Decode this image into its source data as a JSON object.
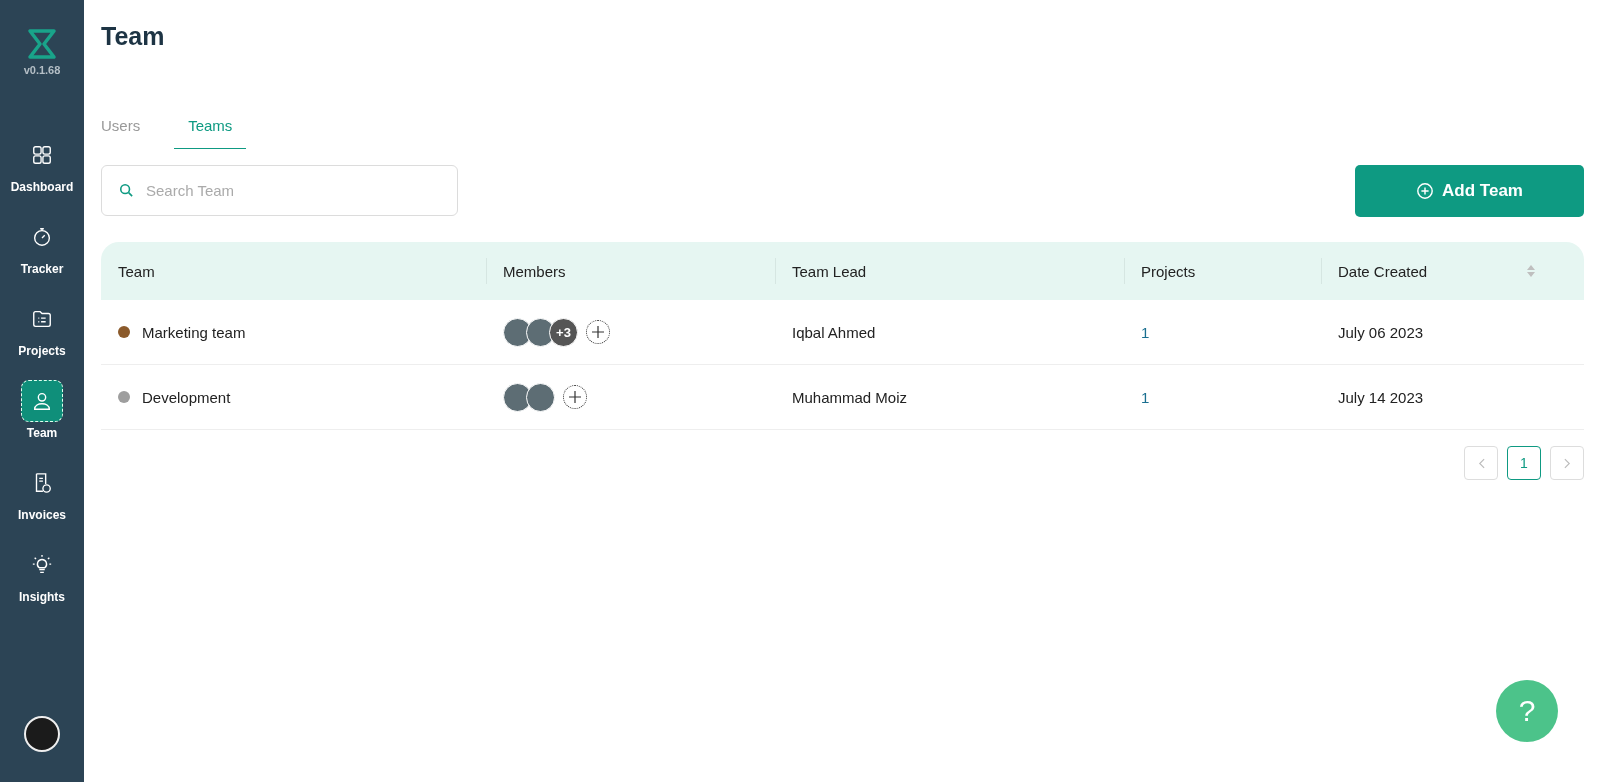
{
  "sidebar": {
    "version": "v0.1.68",
    "items": [
      {
        "kind": "dashboard",
        "label": "Dashboard",
        "selected": false
      },
      {
        "kind": "tracker",
        "label": "Tracker",
        "selected": false
      },
      {
        "kind": "projects",
        "label": "Projects",
        "selected": false
      },
      {
        "kind": "team",
        "label": "Team",
        "selected": true
      },
      {
        "kind": "invoices",
        "label": "Invoices",
        "selected": false
      },
      {
        "kind": "insights",
        "label": "Insights",
        "selected": false
      }
    ]
  },
  "page": {
    "title": "Team"
  },
  "tabs": [
    {
      "label": "Users",
      "selected": false
    },
    {
      "label": "Teams",
      "selected": true
    }
  ],
  "search": {
    "placeholder": "Search Team"
  },
  "add_button": {
    "label": "Add Team"
  },
  "table": {
    "columns": [
      {
        "label": "Team",
        "sortable": false
      },
      {
        "label": "Members",
        "sortable": false
      },
      {
        "label": "Team Lead",
        "sortable": false
      },
      {
        "label": "Projects",
        "sortable": false
      },
      {
        "label": "Date Created",
        "sortable": true
      }
    ],
    "rows": [
      {
        "team": "Marketing team",
        "color": "#8b5a2b",
        "members": [
          {
            "kind": "photo"
          },
          {
            "kind": "photo"
          },
          {
            "kind": "more",
            "label": "+3"
          }
        ],
        "lead": "Iqbal Ahmed",
        "projects": "1",
        "date": "July 06 2023"
      },
      {
        "team": "Development",
        "color": "#9e9e9e",
        "members": [
          {
            "kind": "photo"
          },
          {
            "kind": "photo"
          }
        ],
        "lead": "Muhammad Moiz",
        "projects": "1",
        "date": "July 14 2023"
      }
    ]
  },
  "pagination": {
    "prev_disabled": true,
    "next_disabled": true,
    "pages": [
      {
        "label": "1",
        "selected": true
      }
    ]
  },
  "help_button": {
    "label": "?"
  }
}
